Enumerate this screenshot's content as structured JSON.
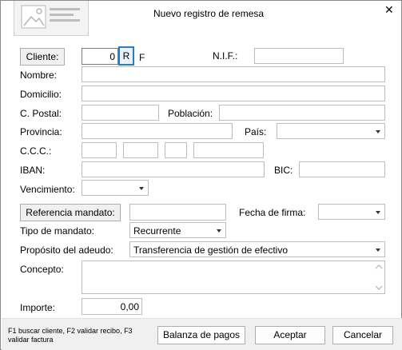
{
  "window": {
    "title": "Nuevo registro de remesa",
    "close_glyph": "✕"
  },
  "cliente": {
    "button_label": "Cliente:",
    "value": "0",
    "r_label": "R",
    "f_label": "F"
  },
  "nif": {
    "label": "N.I.F.:",
    "value": ""
  },
  "nombre": {
    "label": "Nombre:",
    "value": ""
  },
  "domicilio": {
    "label": "Domicilio:",
    "value": ""
  },
  "cpostal": {
    "label": "C. Postal:",
    "value": ""
  },
  "poblacion": {
    "label": "Población:",
    "value": ""
  },
  "provincia": {
    "label": "Provincia:",
    "value": ""
  },
  "pais": {
    "label": "País:",
    "value": ""
  },
  "ccc": {
    "label": "C.C.C.:"
  },
  "iban": {
    "label": "IBAN:",
    "value": ""
  },
  "bic": {
    "label": "BIC:",
    "value": ""
  },
  "vencimiento": {
    "label": "Vencimiento:",
    "value": ""
  },
  "referencia": {
    "button_label": "Referencia mandato:",
    "value": ""
  },
  "fecha_firma": {
    "label": "Fecha de firma:",
    "value": ""
  },
  "tipo_mandato": {
    "label": "Tipo de mandato:",
    "value": "Recurrente"
  },
  "proposito": {
    "label": "Propósito del adeudo:",
    "value": "Transferencia de gestión de efectivo"
  },
  "concepto": {
    "label": "Concepto:",
    "value": ""
  },
  "importe": {
    "label": "Importe:",
    "value": "0,00"
  },
  "footer": {
    "help_text": "F1 buscar cliente, F2 validar recibo, F3 validar factura",
    "balanza_label": "Balanza de pagos",
    "aceptar_label": "Aceptar",
    "cancelar_label": "Cancelar"
  }
}
